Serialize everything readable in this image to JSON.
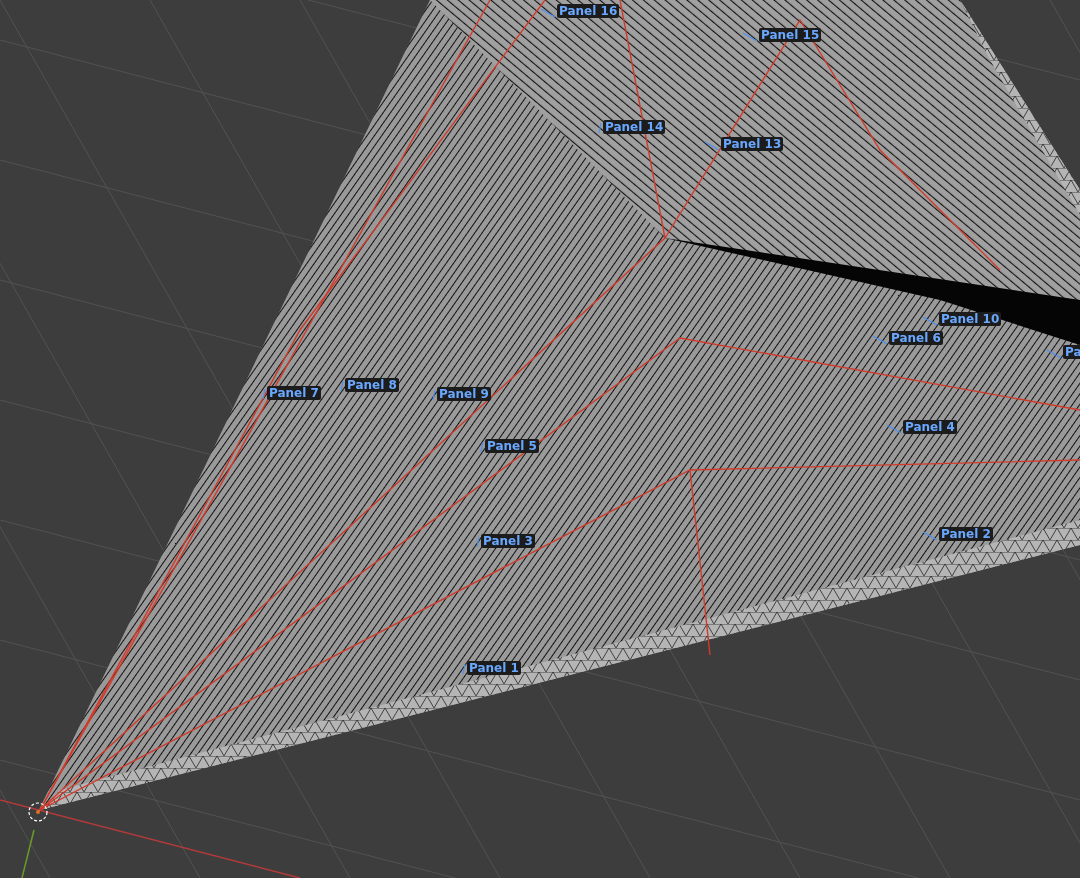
{
  "viewport": {
    "labels": [
      {
        "text": "Panel 16"
      },
      {
        "text": "Panel 15"
      },
      {
        "text": "Panel 14"
      },
      {
        "text": "Panel 13"
      },
      {
        "text": "Panel 10"
      },
      {
        "text": "Pa"
      },
      {
        "text": "Panel 6"
      },
      {
        "text": "Panel 7"
      },
      {
        "text": "Panel 8"
      },
      {
        "text": "Panel 9"
      },
      {
        "text": "Panel 5"
      },
      {
        "text": "Panel 4"
      },
      {
        "text": "Panel 3"
      },
      {
        "text": "Panel 2"
      },
      {
        "text": "Panel 1"
      }
    ]
  }
}
